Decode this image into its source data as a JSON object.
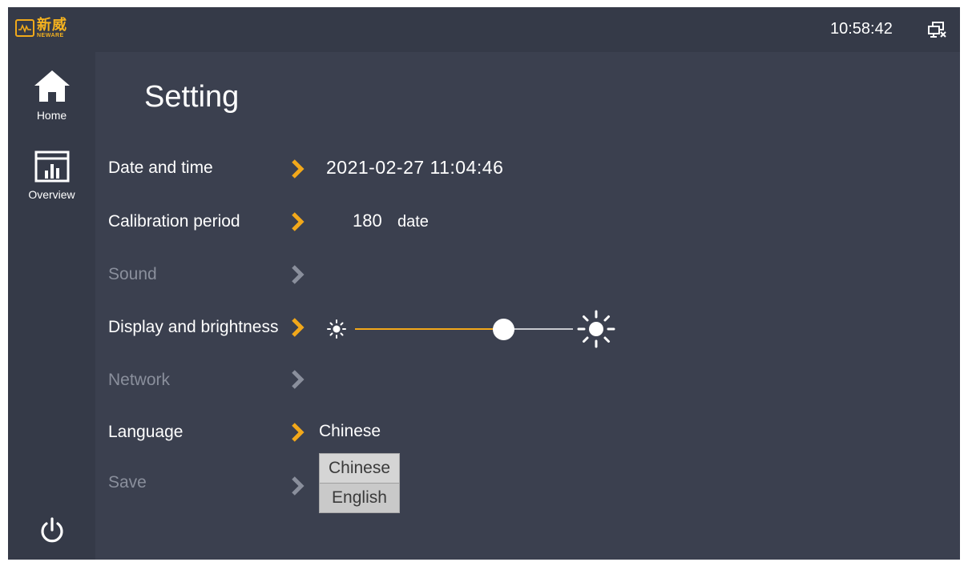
{
  "app": {
    "logo_cn": "新威",
    "logo_en": "NEWARE",
    "clock": "10:58:42"
  },
  "sidebar": {
    "items": [
      {
        "label": "Home",
        "icon": "home-icon"
      },
      {
        "label": "Overview",
        "icon": "overview-icon"
      }
    ],
    "power_icon": "power-icon"
  },
  "page": {
    "title": "Setting"
  },
  "settings": {
    "date_time": {
      "label": "Date and time",
      "value": "2021-02-27  11:04:46"
    },
    "calibration": {
      "label": "Calibration period",
      "value": "180",
      "unit": "date"
    },
    "sound": {
      "label": "Sound"
    },
    "display": {
      "label": "Display and brightness",
      "brightness_fraction": 0.68
    },
    "network": {
      "label": "Network"
    },
    "language": {
      "label": "Language",
      "value": "Chinese",
      "options": [
        "Chinese",
        "English"
      ]
    },
    "save": {
      "label": "Save"
    }
  },
  "colors": {
    "accent": "#f2a81a",
    "background": "#3b404f",
    "panel": "#353a48",
    "text": "#ffffff",
    "disabled_text": "#8a8f9c"
  }
}
